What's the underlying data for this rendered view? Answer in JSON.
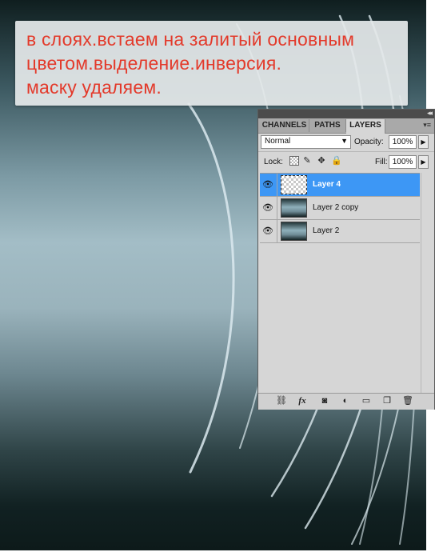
{
  "note": {
    "lines": [
      "в слоях.встаем на залитый основным",
      "цветом.выделение.инверсия.",
      "маску удаляем."
    ]
  },
  "panel": {
    "collapse_glyph": "◂◂",
    "menu_glyph": "▾≡",
    "tabs": [
      {
        "label": "CHANNELS",
        "active": false
      },
      {
        "label": "PATHS",
        "active": false
      },
      {
        "label": "LAYERS",
        "active": true
      }
    ],
    "blend_mode": "Normal",
    "opacity_label": "Opacity:",
    "opacity_value": "100%",
    "lock_label": "Lock:",
    "fill_label": "Fill:",
    "fill_value": "100%",
    "layers": [
      {
        "name": "Layer 4",
        "selected": true,
        "visible": true,
        "thumb": "transparent"
      },
      {
        "name": "Layer 2 copy",
        "selected": false,
        "visible": true,
        "thumb": "gradient"
      },
      {
        "name": "Layer 2",
        "selected": false,
        "visible": true,
        "thumb": "gradient"
      }
    ],
    "bottom_icons": [
      "link-icon",
      "fx-icon",
      "mask-icon",
      "adjustment-icon",
      "group-icon",
      "new-layer-icon",
      "trash-icon"
    ],
    "fx_label": "fx"
  },
  "colors": {
    "note_text": "#e33a2b",
    "selected_layer": "#3d97f5"
  }
}
